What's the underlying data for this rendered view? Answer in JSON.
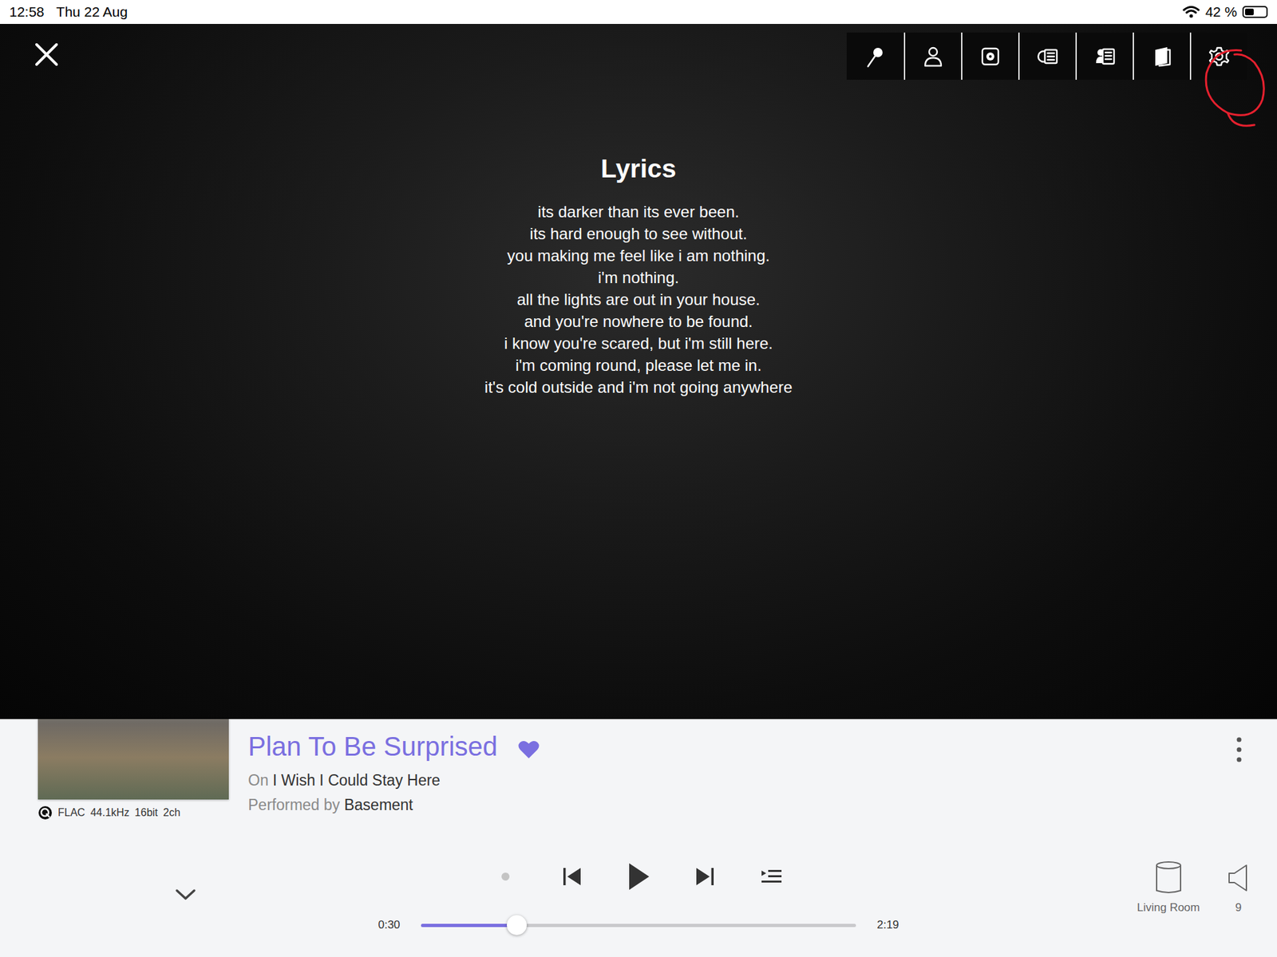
{
  "status_bar": {
    "time": "12:58",
    "date": "Thu 22 Aug",
    "battery": "42 %",
    "battery_level": 0.42
  },
  "lyrics": {
    "title": "Lyrics",
    "lines": [
      "its darker than its ever been.",
      "its hard enough to see without.",
      "you making me feel like i am nothing.",
      "i'm nothing.",
      "all the lights are out in your house.",
      "and you're nowhere to be found.",
      "i know you're scared, but i'm still here.",
      "i'm coming round, please let me in.",
      "it's cold outside and i'm not going anywhere"
    ]
  },
  "now_playing": {
    "title": "Plan To Be Surprised",
    "favorite": true,
    "album_prefix": "On",
    "album": "I Wish I Could Stay Here",
    "artist_prefix": "Performed by",
    "artist": "Basement",
    "format": [
      "FLAC",
      "44.1kHz",
      "16bit",
      "2ch"
    ]
  },
  "transport": {
    "playing": false,
    "position": "0:30",
    "duration": "2:19",
    "level": 0.22
  },
  "zone": {
    "name": "Living Room",
    "volume": "9"
  }
}
